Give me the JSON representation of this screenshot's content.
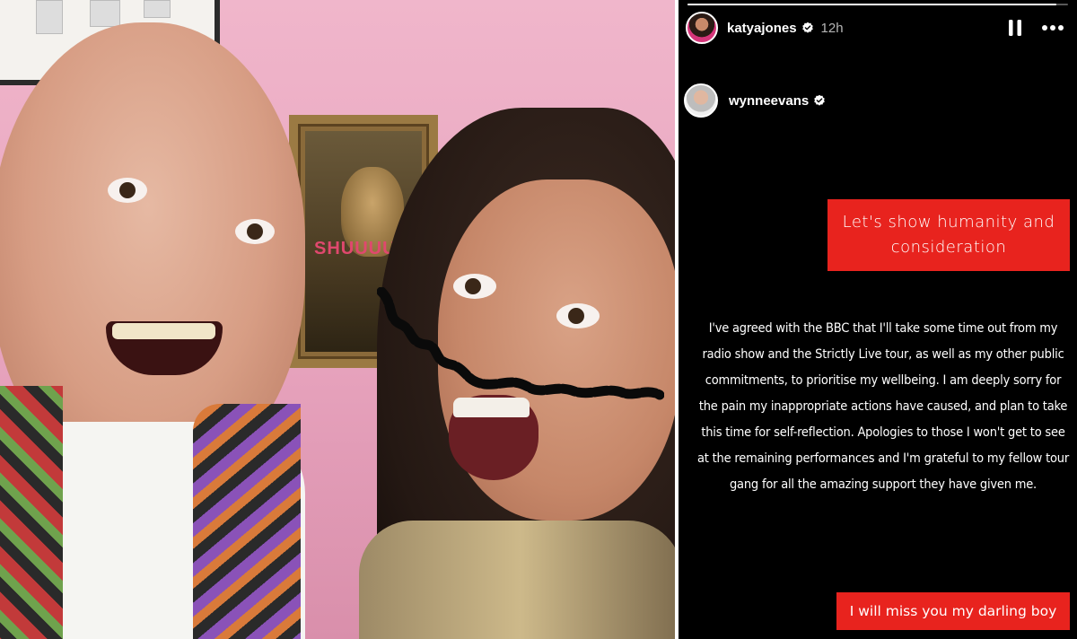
{
  "story": {
    "progress": 0.97,
    "author": {
      "username": "katyajones",
      "verified": true,
      "timestamp": "12h"
    },
    "controls": {
      "pause_icon": "pause-icon",
      "more_icon": "more-options-icon"
    },
    "mention": {
      "username": "wynneevans",
      "verified": true
    },
    "caption_top": "Let's show humanity  and consideration",
    "statement": "I've agreed with the BBC that I'll take some time out from my radio show and the Strictly Live tour, as well as my other public commitments, to prioritise my wellbeing. I am deeply sorry for the pain my inappropriate actions have caused, and plan to take this time for self-reflection. Apologies to those I won't get to see at the remaining performances and I'm grateful to my fellow tour gang for all the amazing support they have given me.",
    "caption_bottom": "I will miss you my darling boy"
  },
  "photo": {
    "painting_text": "SHUUUUUSH"
  },
  "colors": {
    "caption_bg": "#e8231e",
    "story_bg": "#000000",
    "verified_badge": "#ffffff"
  }
}
